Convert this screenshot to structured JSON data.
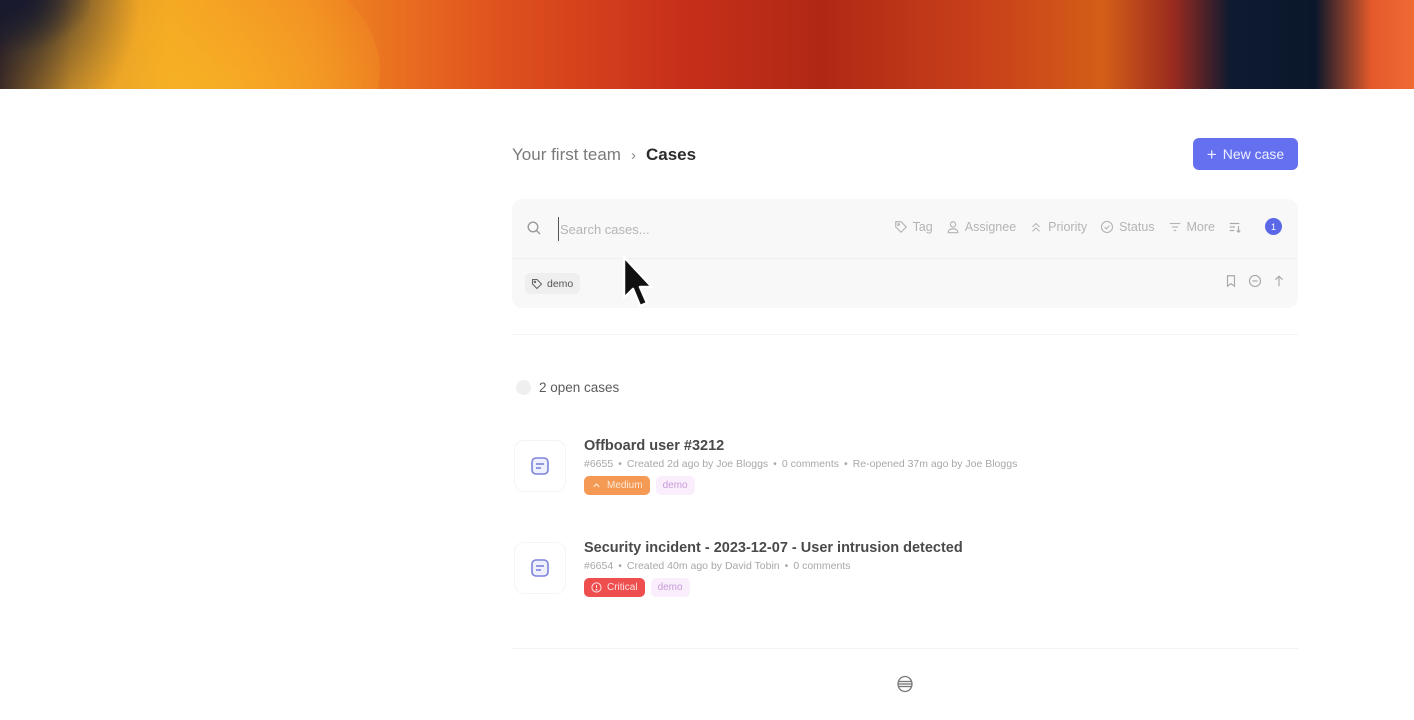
{
  "breadcrumb": {
    "team": "Your first team",
    "separator": "›",
    "current": "Cases"
  },
  "toolbar": {
    "new_case_label": "New case",
    "new_case_icon": "plus-icon"
  },
  "search": {
    "placeholder": "Search cases...",
    "value": "",
    "icon": "search-icon"
  },
  "filters": [
    {
      "label": "Tag",
      "icon": "tag-icon"
    },
    {
      "label": "Assignee",
      "icon": "user-icon"
    },
    {
      "label": "Priority",
      "icon": "chevrons-up-icon"
    },
    {
      "label": "Status",
      "icon": "check-circle-icon"
    },
    {
      "label": "More",
      "icon": "filter-lines-icon"
    }
  ],
  "sort_icon": "sort-icon",
  "active_filter_count": "1",
  "active_tags": [
    {
      "label": "demo",
      "icon": "tag-icon"
    }
  ],
  "view_actions": [
    {
      "name": "bookmark-icon"
    },
    {
      "name": "minus-circle-icon"
    },
    {
      "name": "arrow-up-icon"
    }
  ],
  "summary": {
    "open_cases_label": "2 open cases"
  },
  "cases": [
    {
      "title": "Offboard user #3212",
      "id": "#6655",
      "created": "Created 2d ago by Joe Bloggs",
      "comments": "0 comments",
      "reopened": "Re-opened 37m ago by Joe Bloggs",
      "priority": "Medium",
      "priority_color": "#f59a55",
      "tag": "demo"
    },
    {
      "title": "Security incident - 2023-12-07 - User intrusion detected",
      "id": "#6654",
      "created": "Created 40m ago by David Tobin",
      "comments": "0 comments",
      "priority": "Critical",
      "priority_color": "#ee4e4e",
      "tag": "demo"
    }
  ],
  "colors": {
    "accent": "#6470f0",
    "badge": "#5a67e6",
    "tag_bg": "#faeefd",
    "tag_text": "#c89ad8"
  },
  "footer_icon": "database-icon"
}
